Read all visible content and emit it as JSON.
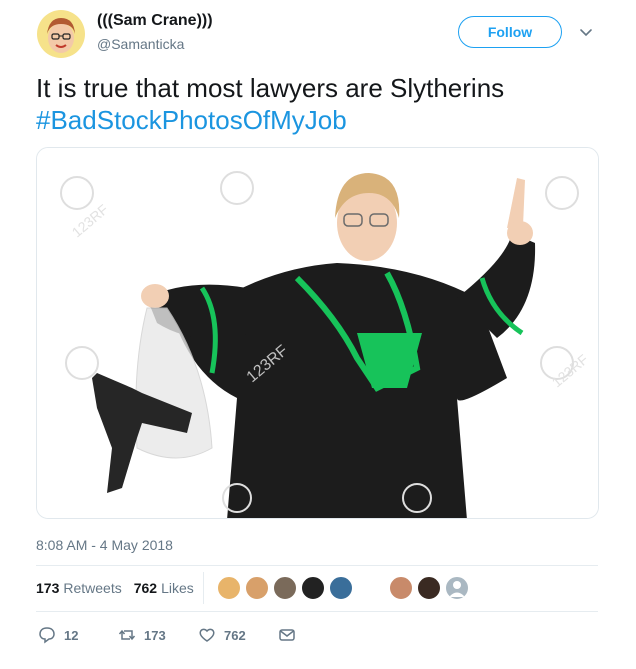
{
  "user": {
    "name": "(((Sam Crane)))",
    "handle": "@Samanticka"
  },
  "header": {
    "follow_label": "Follow"
  },
  "tweet": {
    "text": "It is true that most lawyers are Slytherins",
    "hashtag": "#BadStockPhotosOfMyJob",
    "timestamp": "8:08 AM - 4 May 2018"
  },
  "stats": {
    "retweets_count": "173",
    "retweets_label": "Retweets",
    "likes_count": "762",
    "likes_label": "Likes"
  },
  "actions": {
    "reply_count": "12",
    "retweet_count": "173",
    "like_count": "762"
  },
  "media": {
    "watermark": "123RF"
  },
  "colors": {
    "accent": "#1da1f2",
    "hashtag": "#1b95e0",
    "muted": "#657786",
    "robe": "#1c1c1c",
    "robe_trim": "#17c35a"
  }
}
